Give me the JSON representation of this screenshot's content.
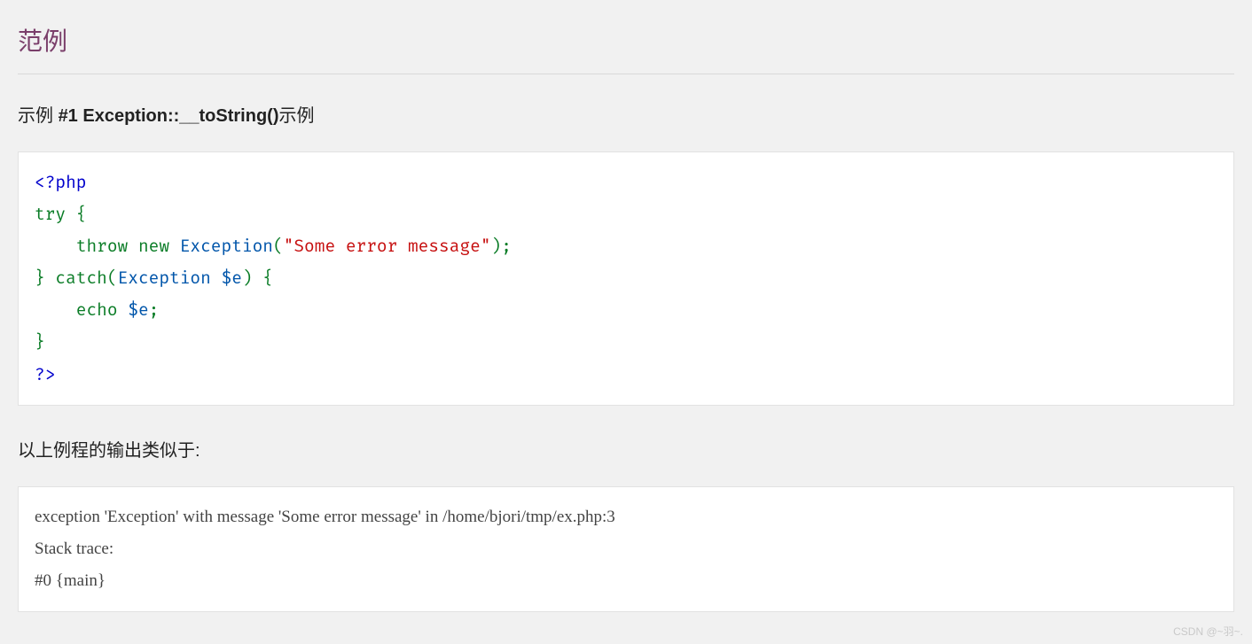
{
  "section_title": "范例",
  "example": {
    "prefix": "示例 ",
    "strong": "#1 Exception::__toString()",
    "suffix": "示例"
  },
  "code": {
    "open_tag": "<?php",
    "try_kw": "try",
    "brace_open": " {",
    "indent": "    ",
    "throw_kw": "throw",
    "space": " ",
    "new_kw": "new",
    "cls": "Exception",
    "paren_open": "(",
    "str": "\"Some error message\"",
    "paren_close_semi": ");",
    "brace_close": "}",
    "catch_kw": "catch",
    "catch_paren_open": "(",
    "catch_cls": "Exception",
    "catch_var": "$e",
    "catch_paren_close": ")",
    "brace_open2": " {",
    "echo_kw": "echo",
    "echo_var": "$e",
    "semi": ";",
    "close_tag": "?>"
  },
  "output_title": "以上例程的输出类似于:",
  "output": {
    "line1": "exception 'Exception' with message 'Some error message' in /home/bjori/tmp/ex.php:3",
    "line2": "Stack trace:",
    "line3": "#0 {main}"
  },
  "watermark": "CSDN @~羽~."
}
